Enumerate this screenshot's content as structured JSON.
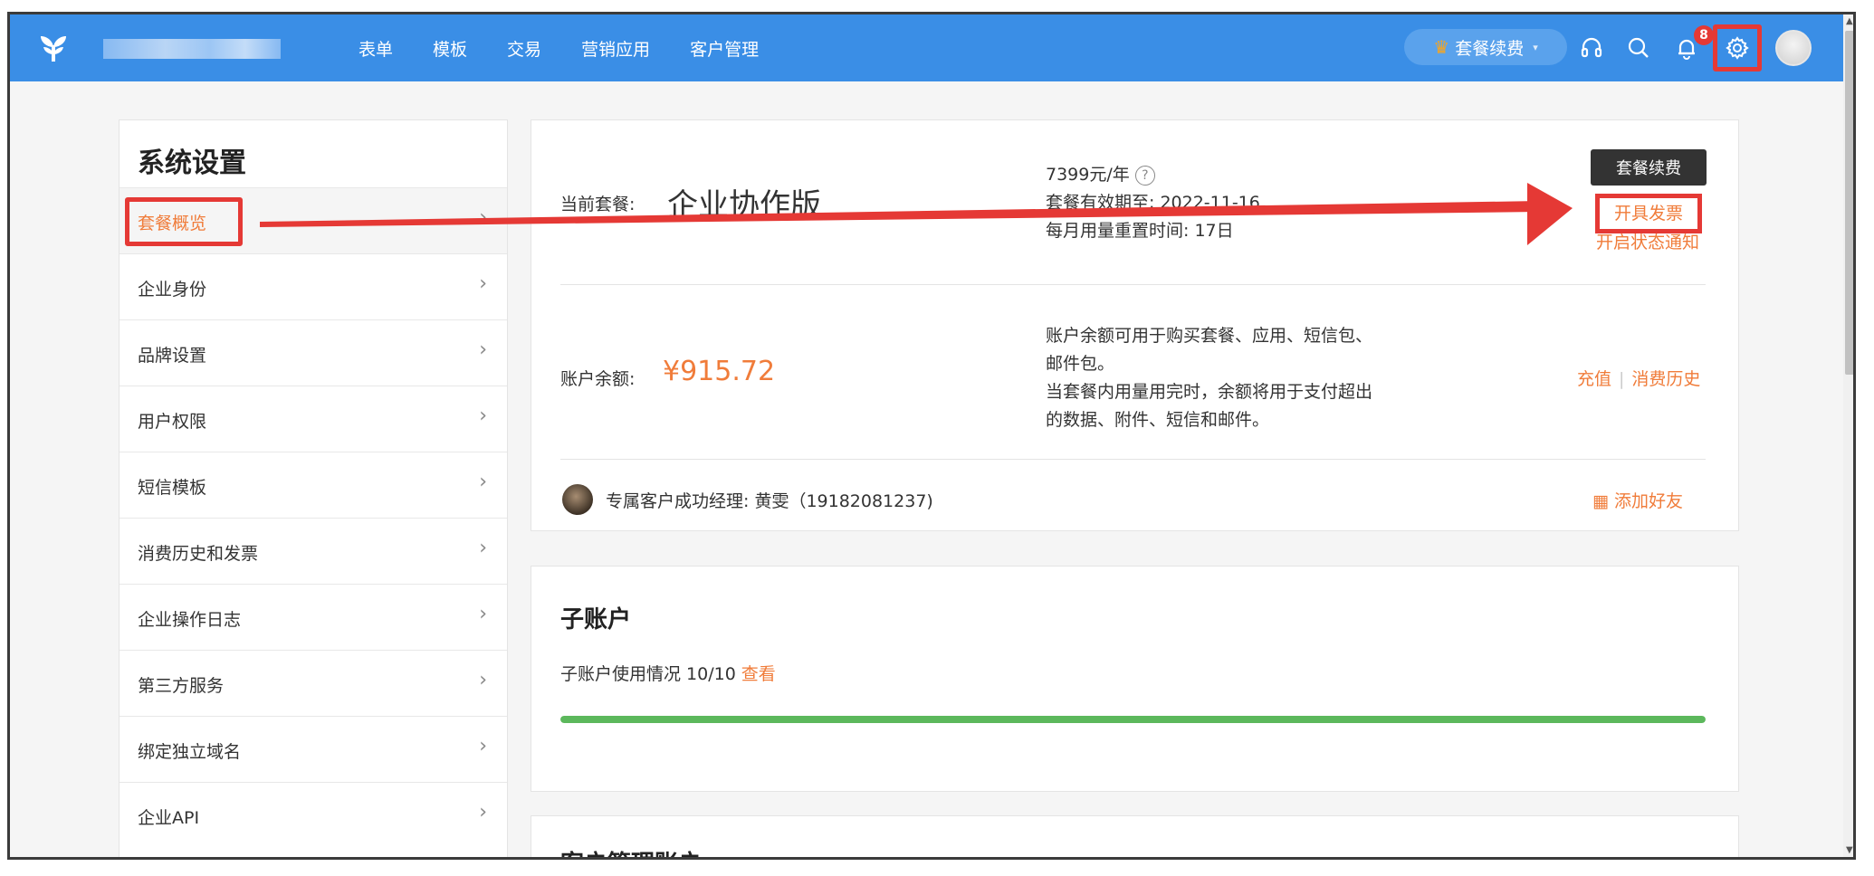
{
  "header": {
    "nav": [
      "表单",
      "模板",
      "交易",
      "营销应用",
      "客户管理"
    ],
    "renew_label": "套餐续费",
    "notification_count": "8",
    "colors": {
      "topbar": "#3a8ee6",
      "accent": "#f07c3a",
      "highlight": "#e53935"
    }
  },
  "sidebar": {
    "title": "系统设置",
    "items": [
      {
        "label": "套餐概览",
        "active": true
      },
      {
        "label": "企业身份"
      },
      {
        "label": "品牌设置"
      },
      {
        "label": "用户权限"
      },
      {
        "label": "短信模板"
      },
      {
        "label": "消费历史和发票"
      },
      {
        "label": "企业操作日志"
      },
      {
        "label": "第三方服务"
      },
      {
        "label": "绑定独立域名"
      },
      {
        "label": "企业API"
      }
    ]
  },
  "plan": {
    "label": "当前套餐:",
    "name": "企业协作版",
    "price": "7399元/年",
    "expiry": "套餐有效期至:  2022-11-16",
    "reset": "每月用量重置时间: 17日",
    "renew_button": "套餐续费",
    "invoice_link": "开具发票",
    "notify_link": "开启状态通知"
  },
  "balance": {
    "label": "账户余额:",
    "amount": "¥915.72",
    "info_line1": "账户余额可用于购买套餐、应用、短信包、",
    "info_line2": "邮件包。",
    "info_line3": "当套餐内用量用完时，余额将用于支付超出",
    "info_line4": "的数据、附件、短信和邮件。",
    "recharge_link": "充值",
    "history_link": "消费历史"
  },
  "manager": {
    "text": "专属客户成功经理: 黄雯（19182081237)",
    "add_friend": "添加好友"
  },
  "sub_account": {
    "title": "子账户",
    "usage_text": "子账户使用情况 10/10",
    "view_link": "查看",
    "usage_fraction": 1.0
  },
  "customer_account": {
    "title": "客户管理账户"
  }
}
